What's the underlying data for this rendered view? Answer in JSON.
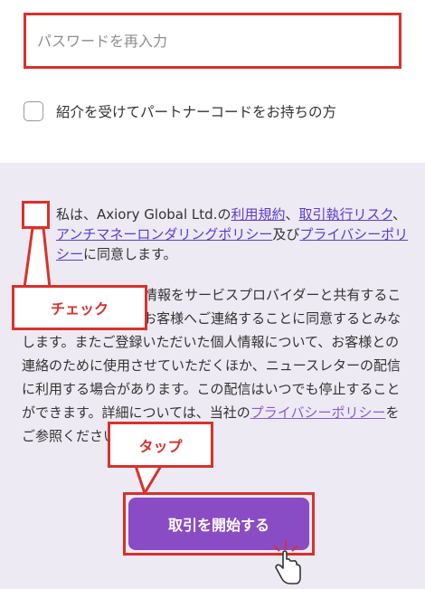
{
  "password_field": {
    "placeholder": "パスワードを再入力"
  },
  "referral": {
    "label": "紹介を受けてパートナーコードをお持ちの方"
  },
  "agreement": {
    "prefix": "私は、Axiory Global Ltd.の",
    "terms_link": "利用規約",
    "sep1": "、",
    "risk_link": "取引執行リスク",
    "sep2": "、",
    "aml_link": "アンチマネーロンダリングポリシー",
    "and": "及び",
    "privacy_link": "プライバシーポリシー",
    "suffix": "に同意します。"
  },
  "privacy": {
    "text1": "私は、お客様の個人情報をサービスプロバイダーと共有すること、および弊社よりお客様へご連絡することに同意するとみなします。またご登録いただいた個人情報について、お客様との連絡のために使用させていただくほか、ニュースレターの配信に利用する場合があります。この配信はいつでも停止することができます。詳細については、当社の",
    "link": "プライバシーポリシー",
    "text2": "をご参照ください。"
  },
  "callouts": {
    "check": "チェック",
    "tap": "タップ"
  },
  "start_button": {
    "label": "取引を開始する"
  },
  "colors": {
    "highlight": "#d9312b",
    "button": "#8a4cc5",
    "link": "#5b3bd1",
    "panel": "#eeeaf4"
  }
}
